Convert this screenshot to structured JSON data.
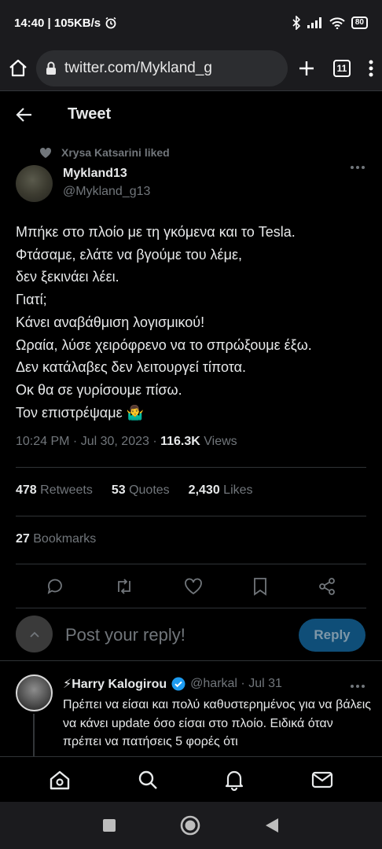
{
  "status_bar": {
    "time": "14:40",
    "speed": "105KB/s",
    "battery": "80"
  },
  "browser": {
    "url": "twitter.com/Mykland_g",
    "tabs": "11"
  },
  "header": {
    "title": "Tweet"
  },
  "social_context": "Xrysa Katsarini liked",
  "author": {
    "name": "Mykland13",
    "handle": "@Mykland_g13"
  },
  "tweet": {
    "lines": [
      "Μπήκε στο πλοίο με τη γκόμενα και το Tesla.",
      "Φτάσαμε, ελάτε να βγούμε του λέμε,",
      "δεν ξεκινάει λέει.",
      "Γιατί;",
      "Κάνει αναβάθμιση λογισμικού!",
      "Ωραία, λύσε χειρόφρενο να  το σπρώξουμε έξω.",
      "Δεν κατάλαβες δεν λειτουργεί τίποτα.",
      "Οκ θα σε γυρίσουμε πίσω.",
      "Τον επιστρέψαμε 🤷‍♂️"
    ],
    "timestamp": "10:24 PM · Jul 30, 2023 · ",
    "views_count": "116.3K",
    "views_label": " Views"
  },
  "stats": {
    "retweets_count": "478",
    "retweets_label": " Retweets",
    "quotes_count": "53",
    "quotes_label": " Quotes",
    "likes_count": "2,430",
    "likes_label": " Likes",
    "bookmarks_count": "27",
    "bookmarks_label": " Bookmarks"
  },
  "actions": [
    "reply-icon",
    "retweet-icon",
    "like-icon",
    "bookmark-icon",
    "share-icon"
  ],
  "reply_composer": {
    "placeholder": "Post your reply!",
    "button": "Reply"
  },
  "reply": {
    "name": "⚡Harry Kalogirou",
    "handle": "@harkal · Jul 31",
    "text": "Πρέπει να είσαι και πολύ καθυστερημένος για να βάλεις να κάνει update όσο είσαι στο πλοίο. Ειδικά όταν πρέπει να πατήσεις 5 φορές ότι"
  },
  "bottom_nav": [
    "home-icon",
    "search-icon",
    "notifications-icon",
    "messages-icon"
  ],
  "colors": {
    "background": "#000000",
    "text": "#e7e9ea",
    "muted": "#71767b",
    "accent": "#1d9bf0"
  }
}
